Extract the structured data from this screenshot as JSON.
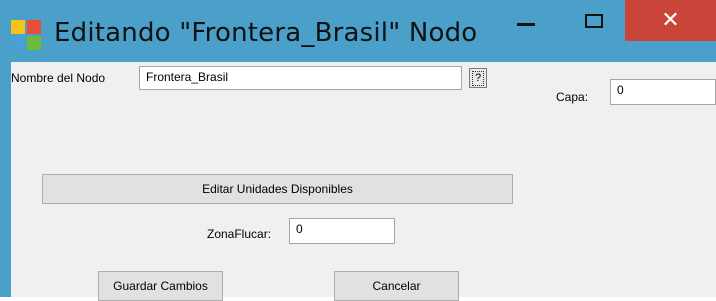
{
  "window": {
    "title": "Editando \"Frontera_Brasil\" Nodo",
    "close_glyph": "✕"
  },
  "form": {
    "nombre_label": "Nombre del Nodo",
    "nombre_value": "Frontera_Brasil",
    "help_glyph": "?",
    "capa_label": "Capa:",
    "capa_value": "0",
    "editar_unidades_label": "Editar Unidades Disponibles",
    "zona_label": "ZonaFlucar:",
    "zona_value": "0",
    "guardar_label": "Guardar Cambios",
    "cancelar_label": "Cancelar"
  }
}
